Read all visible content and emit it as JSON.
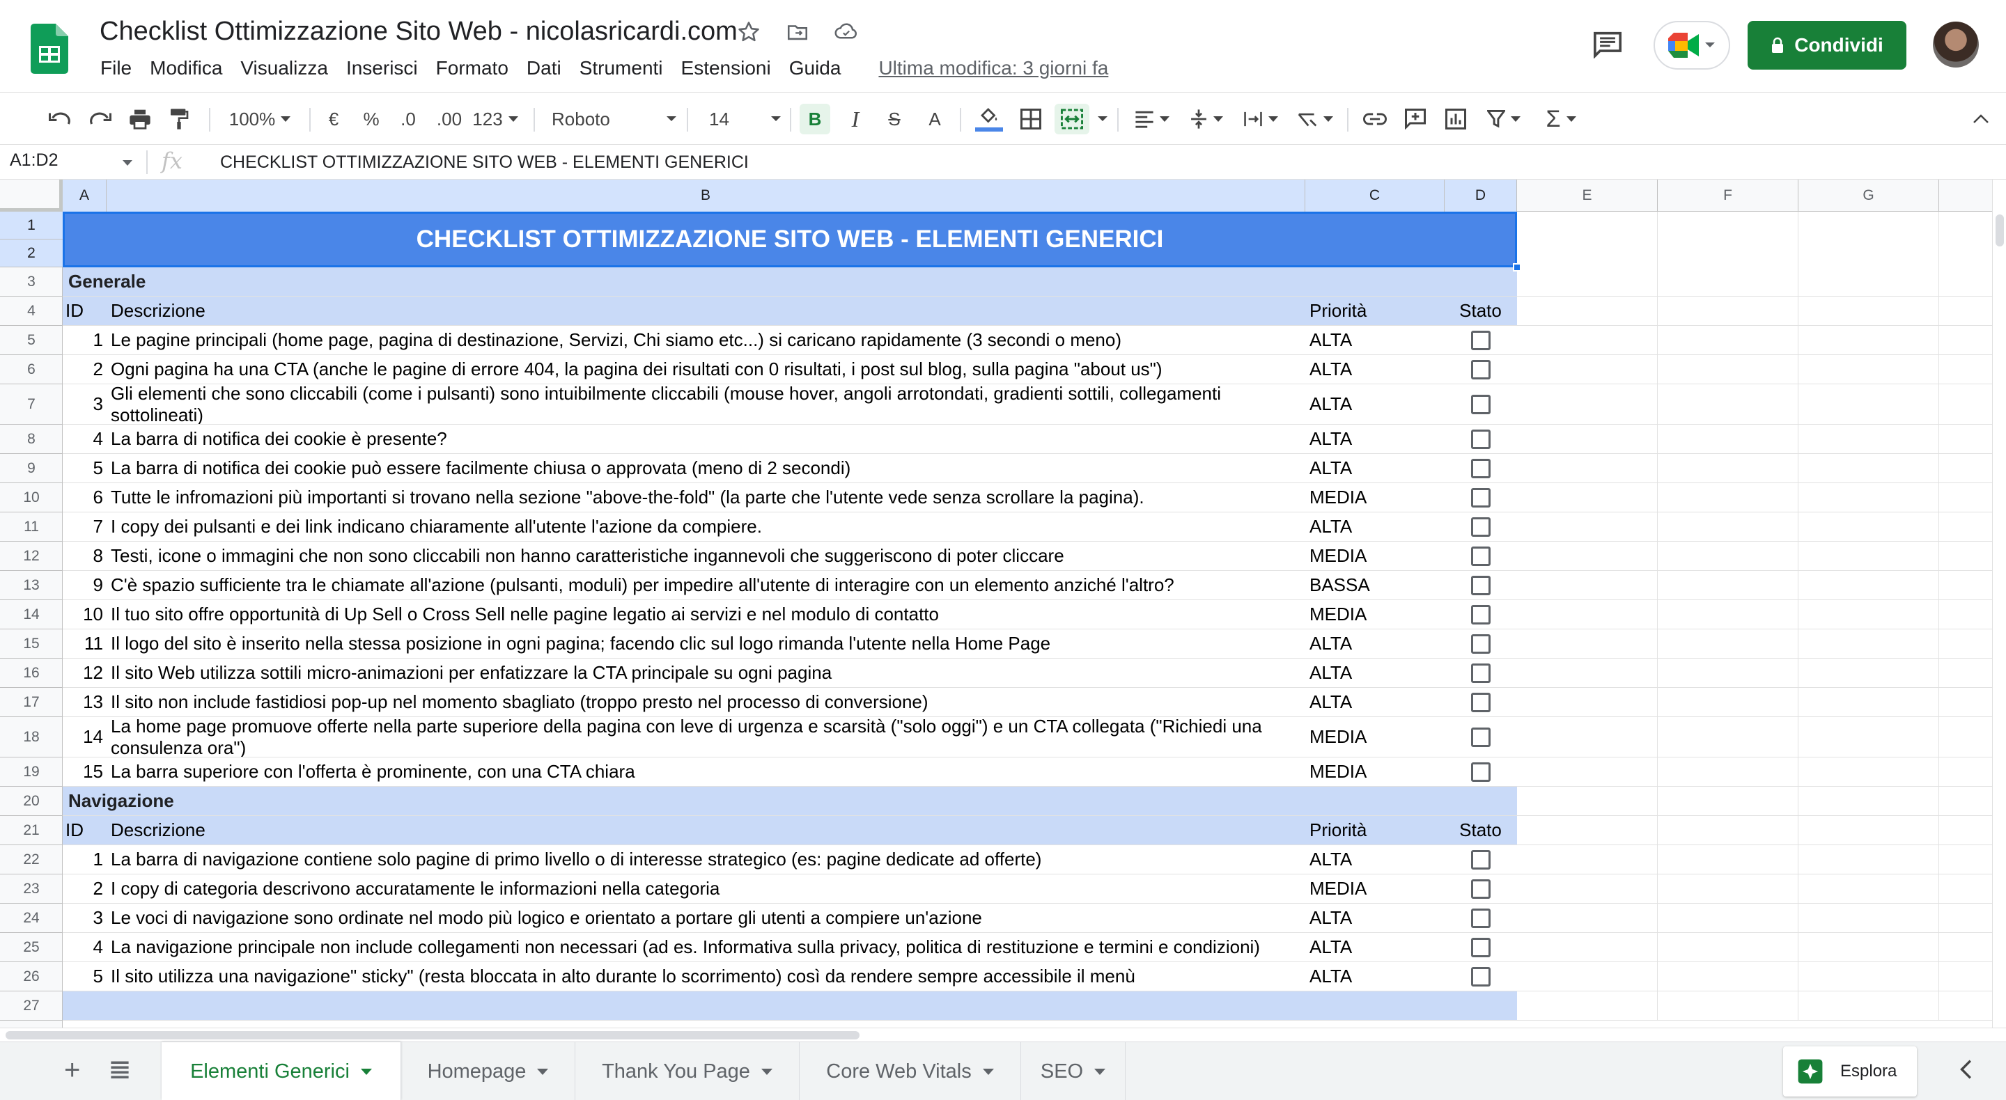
{
  "app": {
    "doc_title": "Checklist Ottimizzazione Sito Web - nicolasricardi.com",
    "menus": [
      "File",
      "Modifica",
      "Visualizza",
      "Inserisci",
      "Formato",
      "Dati",
      "Strumenti",
      "Estensioni",
      "Guida"
    ],
    "last_edit": "Ultima modifica: 3 giorni fa",
    "share_label": "Condividi"
  },
  "toolbar": {
    "zoom": "100%",
    "currency": "€",
    "percent": "%",
    "dec_less": ".0",
    "dec_more": ".00",
    "num_format": "123",
    "font": "Roboto",
    "font_size": "14",
    "bold": "B",
    "italic": "I",
    "strike": "S",
    "text_color": "A"
  },
  "formula_bar": {
    "name_box": "A1:D2",
    "fx": "fx",
    "content": "CHECKLIST OTTIMIZZAZIONE SITO WEB - ELEMENTI GENERICI"
  },
  "columns": [
    "A",
    "B",
    "C",
    "D",
    "E",
    "F",
    "G"
  ],
  "row_numbers": [
    "1",
    "2",
    "3",
    "4",
    "5",
    "6",
    "7",
    "8",
    "9",
    "10",
    "11",
    "12",
    "13",
    "14",
    "15",
    "16",
    "17",
    "18",
    "19",
    "20",
    "21",
    "22",
    "23",
    "24",
    "25",
    "26",
    "27"
  ],
  "sheet": {
    "banner": "CHECKLIST OTTIMIZZAZIONE SITO WEB - ELEMENTI GENERICI",
    "sections": [
      {
        "title": "Generale",
        "headers": {
          "id": "ID",
          "desc": "Descrizione",
          "priority": "Priorità",
          "status": "Stato"
        },
        "items": [
          {
            "id": "1",
            "desc": "Le pagine principali (home page, pagina di destinazione, Servizi, Chi siamo etc...) si caricano rapidamente (3 secondi o meno)",
            "priority": "ALTA"
          },
          {
            "id": "2",
            "desc": "Ogni pagina ha una CTA (anche le pagine di errore 404, la pagina dei risultati con 0 risultati, i post sul blog, sulla pagina \"about us\")",
            "priority": "ALTA"
          },
          {
            "id": "3",
            "desc": "Gli elementi che sono cliccabili (come i pulsanti) sono intuibilmente cliccabili (mouse hover, angoli arrotondati, gradienti sottili, collegamenti sottolineati)",
            "priority": "ALTA"
          },
          {
            "id": "4",
            "desc": "La barra di notifica dei cookie è presente?",
            "priority": "ALTA"
          },
          {
            "id": "5",
            "desc": "La barra di notifica dei cookie può essere facilmente chiusa o approvata (meno di 2 secondi)",
            "priority": "ALTA"
          },
          {
            "id": "6",
            "desc": "Tutte le infromazioni più importanti si trovano nella sezione \"above-the-fold\" (la parte che l'utente vede senza scrollare la pagina).",
            "priority": "MEDIA"
          },
          {
            "id": "7",
            "desc": "I copy dei pulsanti e dei link indicano chiaramente all'utente l'azione da compiere.",
            "priority": "ALTA"
          },
          {
            "id": "8",
            "desc": "Testi, icone o immagini che non sono cliccabili non hanno caratteristiche ingannevoli che suggeriscono di poter cliccare",
            "priority": "MEDIA"
          },
          {
            "id": "9",
            "desc": "C'è spazio sufficiente tra le chiamate all'azione (pulsanti, moduli) per impedire all'utente di interagire con un elemento anziché l'altro?",
            "priority": "BASSA"
          },
          {
            "id": "10",
            "desc": "Il tuo sito offre opportunità di Up Sell o Cross Sell nelle pagine legatio ai servizi e nel modulo di contatto",
            "priority": "MEDIA"
          },
          {
            "id": "11",
            "desc": "Il logo del sito è inserito nella stessa posizione in ogni pagina; facendo clic sul logo rimanda l'utente nella Home Page",
            "priority": "ALTA"
          },
          {
            "id": "12",
            "desc": "Il sito Web utilizza sottili micro-animazioni per enfatizzare la CTA principale su ogni pagina",
            "priority": "ALTA"
          },
          {
            "id": "13",
            "desc": "Il sito non include fastidiosi pop-up nel momento sbagliato (troppo presto nel processo di conversione)",
            "priority": "ALTA"
          },
          {
            "id": "14",
            "desc": "La home page promuove offerte nella parte superiore della pagina con leve di urgenza e scarsità (\"solo oggi\") e un CTA collegata (\"Richiedi una consulenza ora\")",
            "priority": "MEDIA"
          },
          {
            "id": "15",
            "desc": "La barra superiore con l'offerta è prominente, con una CTA chiara",
            "priority": "MEDIA"
          }
        ]
      },
      {
        "title": "Navigazione",
        "headers": {
          "id": "ID",
          "desc": "Descrizione",
          "priority": "Priorità",
          "status": "Stato"
        },
        "items": [
          {
            "id": "1",
            "desc": "La barra di navigazione contiene solo pagine di primo livello o di interesse strategico (es: pagine dedicate ad offerte)",
            "priority": "ALTA"
          },
          {
            "id": "2",
            "desc": "I copy di categoria descrivono accuratamente le informazioni nella categoria",
            "priority": "MEDIA"
          },
          {
            "id": "3",
            "desc": "Le voci di navigazione sono ordinate nel modo più logico e orientato a portare gli utenti a compiere un'azione",
            "priority": "ALTA"
          },
          {
            "id": "4",
            "desc": "La navigazione principale non include collegamenti non necessari (ad es. Informativa sulla privacy, politica di restituzione e termini e condizioni)",
            "priority": "ALTA"
          },
          {
            "id": "5",
            "desc": "Il sito utilizza una navigazione\" sticky\" (resta bloccata in alto durante lo scorrimento) così da rendere sempre accessibile il menù",
            "priority": "ALTA"
          }
        ]
      }
    ]
  },
  "tabs": {
    "items": [
      "Elementi Generici",
      "Homepage",
      "Thank You Page",
      "Core Web Vitals",
      "SEO"
    ],
    "active": "Elementi Generici",
    "explore_label": "Esplora"
  },
  "colors": {
    "banner": "#4a86e8",
    "section_bg": "#c9daf8",
    "share_green": "#188038",
    "selection": "#1a73e8"
  }
}
